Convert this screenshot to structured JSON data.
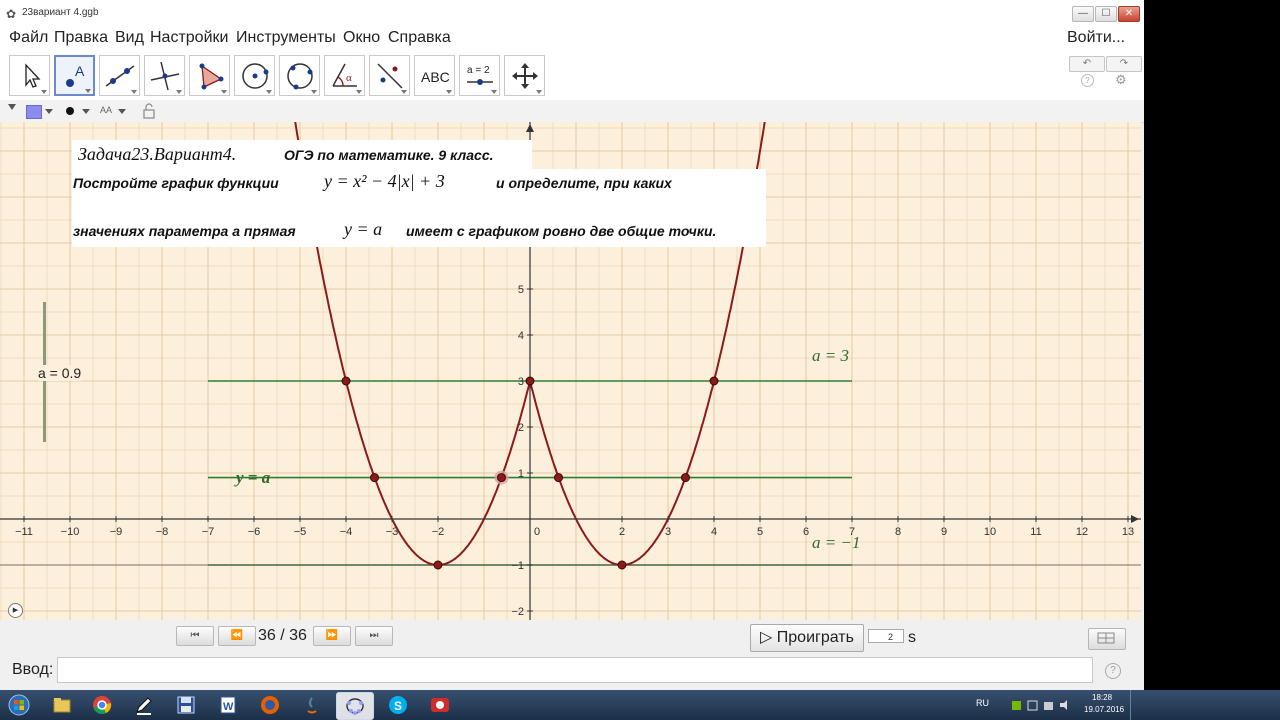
{
  "window": {
    "title": "23вариант 4.ggb",
    "controls": [
      "—",
      "☐",
      "✕"
    ]
  },
  "menu": {
    "items": [
      "Файл",
      "Правка",
      "Вид",
      "Настройки",
      "Инструменты",
      "Окно",
      "Справка"
    ],
    "login": "Войти..."
  },
  "toolbar": {
    "tools": [
      {
        "name": "move-tool-icon"
      },
      {
        "name": "point-tool-icon"
      },
      {
        "name": "line-tool-icon"
      },
      {
        "name": "perpendicular-line-tool-icon"
      },
      {
        "name": "polygon-tool-icon"
      },
      {
        "name": "circle-tool-icon"
      },
      {
        "name": "circle-three-points-tool-icon"
      },
      {
        "name": "angle-tool-icon",
        "glyph": "α"
      },
      {
        "name": "reflect-tool-icon"
      },
      {
        "name": "text-tool-icon",
        "label": "ABC"
      },
      {
        "name": "slider-tool-icon",
        "label": "a = 2"
      },
      {
        "name": "move-view-tool-icon"
      }
    ],
    "undo": "↶",
    "redo": "↷",
    "help": "?",
    "settings": "⚙"
  },
  "stylebar": {
    "text_size_label": "AA"
  },
  "problem": {
    "heading_math": "Задача23.Вариант4.",
    "heading_rest": "ОГЭ по математике. 9 класс.",
    "line1_start": "Постройте график функции",
    "line1_math": "y = x² − 4|x| + 3",
    "line1_end": "и определите, при каких",
    "line2_start": "значениях параметра а прямая",
    "line2_math": "y = a",
    "line2_end": "имеет с графиком ровно две общие точки."
  },
  "slider": {
    "label": "a = 0.9",
    "value": 0.9,
    "min": -5,
    "max": 5
  },
  "graph": {
    "colors": {
      "background": "#fcefdb",
      "minor_grid": "#f0dcc0",
      "major_grid": "#e3c8a3",
      "axes": "#333333",
      "curve": "#8b1a1a",
      "lines": "#2e7d32",
      "point": "#8b1a1a"
    },
    "x_ticks": [
      "−11",
      "−10",
      "−9",
      "−8",
      "−7",
      "−6",
      "−5",
      "−4",
      "−3",
      "−2",
      "0",
      "2",
      "3",
      "4",
      "5",
      "6",
      "7",
      "8",
      "9",
      "10",
      "11",
      "12",
      "13"
    ],
    "x_tick_values": [
      -11,
      -10,
      -9,
      -8,
      -7,
      -6,
      -5,
      -4,
      -3,
      -2,
      0,
      2,
      3,
      4,
      5,
      6,
      7,
      8,
      9,
      10,
      11,
      12,
      13
    ],
    "y_ticks": [
      "−2",
      "−1",
      "1",
      "2",
      "3",
      "4",
      "5"
    ],
    "y_tick_values": [
      -2,
      -1,
      1,
      2,
      3,
      4,
      5
    ],
    "horizontal_lines": [
      {
        "y": 3,
        "x_from": -7,
        "x_to": 7
      },
      {
        "y": 0.9,
        "x_from": -7,
        "x_to": 7
      },
      {
        "y": -1,
        "x_from": -7,
        "x_to": 7
      }
    ],
    "line_labels": {
      "a3": "a = 3",
      "ya": "y = a",
      "am1": "a = −1"
    },
    "points": [
      {
        "x": -4,
        "y": 3
      },
      {
        "x": 0,
        "y": 3
      },
      {
        "x": 4,
        "y": 3
      },
      {
        "x": -3.38,
        "y": 0.9
      },
      {
        "x": -0.62,
        "y": 0.9
      },
      {
        "x": 0.62,
        "y": 0.9
      },
      {
        "x": 3.38,
        "y": 0.9
      },
      {
        "x": -2,
        "y": -1
      },
      {
        "x": 2,
        "y": -1
      }
    ],
    "highlighted_point": {
      "x": -0.62,
      "y": 0.9
    }
  },
  "playback": {
    "first": "⏮",
    "prev": "⏪",
    "next": "⏩",
    "last": "⏭",
    "counter": "36 / 36",
    "play_label": "▷ Проиграть",
    "speed": "2",
    "unit": "s"
  },
  "input": {
    "label": "Ввод:",
    "value": "",
    "help": "?"
  },
  "taskbar": {
    "lang": "RU",
    "time": "18:28",
    "date": "19.07.2016"
  }
}
